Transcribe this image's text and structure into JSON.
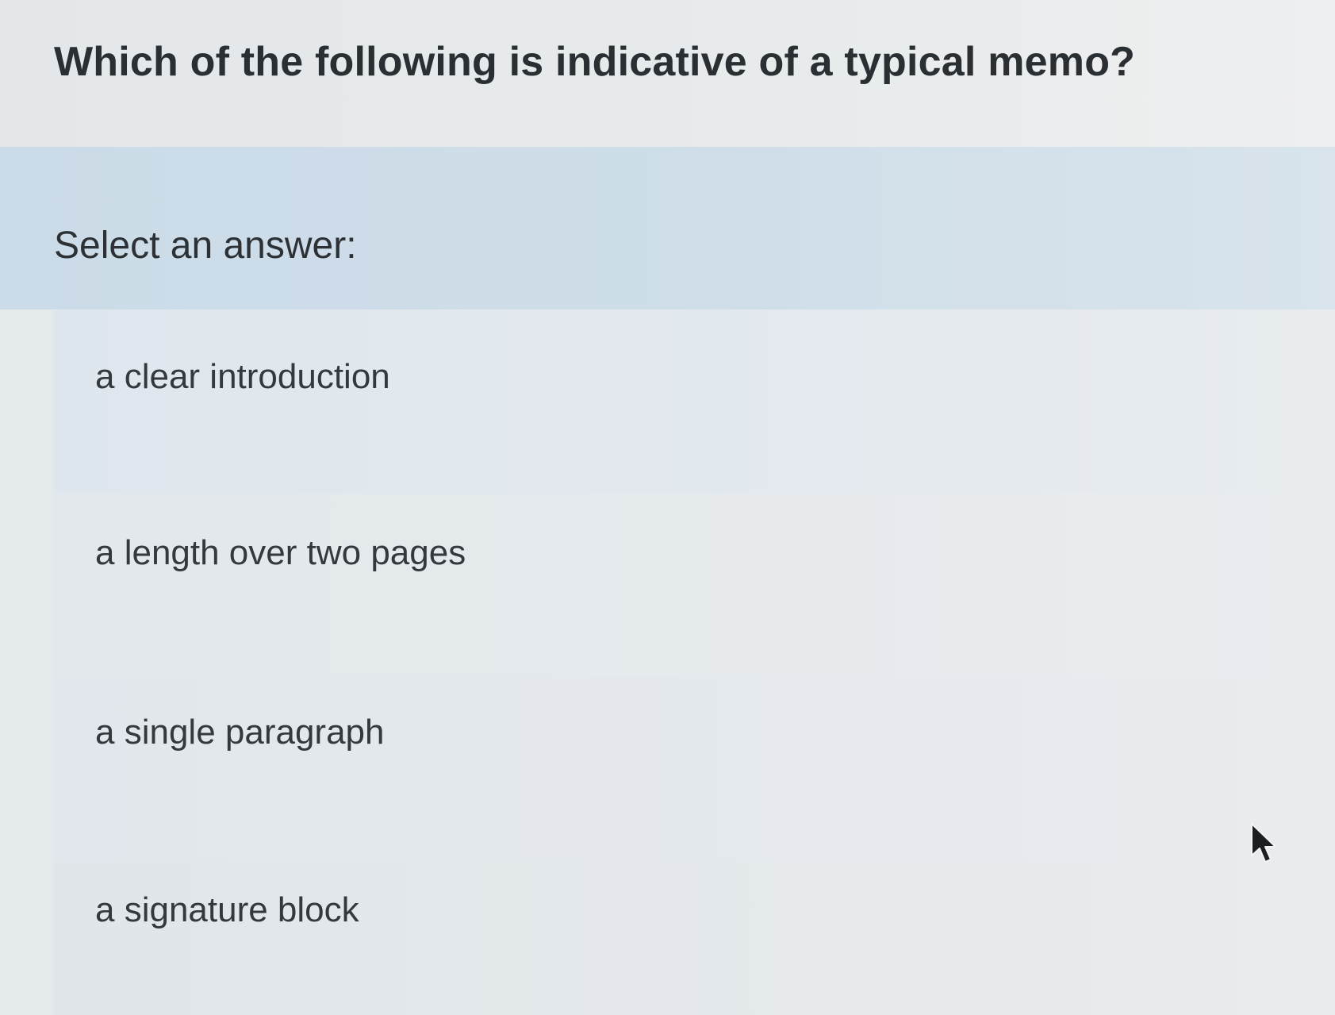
{
  "question": {
    "text": "Which of the following is indicative of a typical memo?"
  },
  "prompt": {
    "label": "Select an answer:"
  },
  "options": [
    {
      "label": "a clear introduction"
    },
    {
      "label": "a length over two pages"
    },
    {
      "label": "a single paragraph"
    },
    {
      "label": "a signature block"
    }
  ],
  "colors": {
    "prompt_band": "#cfdee9",
    "background": "#e6ebee",
    "text": "#2a2f33"
  },
  "cursor": {
    "icon": "mouse-pointer-icon"
  }
}
